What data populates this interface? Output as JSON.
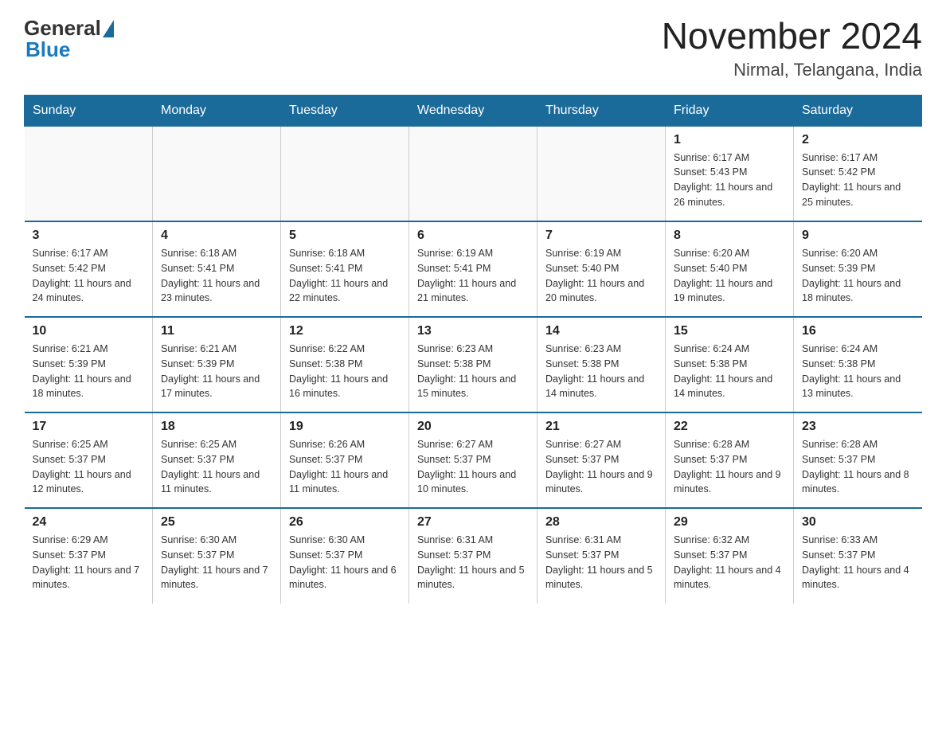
{
  "header": {
    "logo_general": "General",
    "logo_blue": "Blue",
    "month": "November 2024",
    "location": "Nirmal, Telangana, India"
  },
  "days_of_week": [
    "Sunday",
    "Monday",
    "Tuesday",
    "Wednesday",
    "Thursday",
    "Friday",
    "Saturday"
  ],
  "weeks": [
    [
      {
        "day": "",
        "info": ""
      },
      {
        "day": "",
        "info": ""
      },
      {
        "day": "",
        "info": ""
      },
      {
        "day": "",
        "info": ""
      },
      {
        "day": "",
        "info": ""
      },
      {
        "day": "1",
        "info": "Sunrise: 6:17 AM\nSunset: 5:43 PM\nDaylight: 11 hours and 26 minutes."
      },
      {
        "day": "2",
        "info": "Sunrise: 6:17 AM\nSunset: 5:42 PM\nDaylight: 11 hours and 25 minutes."
      }
    ],
    [
      {
        "day": "3",
        "info": "Sunrise: 6:17 AM\nSunset: 5:42 PM\nDaylight: 11 hours and 24 minutes."
      },
      {
        "day": "4",
        "info": "Sunrise: 6:18 AM\nSunset: 5:41 PM\nDaylight: 11 hours and 23 minutes."
      },
      {
        "day": "5",
        "info": "Sunrise: 6:18 AM\nSunset: 5:41 PM\nDaylight: 11 hours and 22 minutes."
      },
      {
        "day": "6",
        "info": "Sunrise: 6:19 AM\nSunset: 5:41 PM\nDaylight: 11 hours and 21 minutes."
      },
      {
        "day": "7",
        "info": "Sunrise: 6:19 AM\nSunset: 5:40 PM\nDaylight: 11 hours and 20 minutes."
      },
      {
        "day": "8",
        "info": "Sunrise: 6:20 AM\nSunset: 5:40 PM\nDaylight: 11 hours and 19 minutes."
      },
      {
        "day": "9",
        "info": "Sunrise: 6:20 AM\nSunset: 5:39 PM\nDaylight: 11 hours and 18 minutes."
      }
    ],
    [
      {
        "day": "10",
        "info": "Sunrise: 6:21 AM\nSunset: 5:39 PM\nDaylight: 11 hours and 18 minutes."
      },
      {
        "day": "11",
        "info": "Sunrise: 6:21 AM\nSunset: 5:39 PM\nDaylight: 11 hours and 17 minutes."
      },
      {
        "day": "12",
        "info": "Sunrise: 6:22 AM\nSunset: 5:38 PM\nDaylight: 11 hours and 16 minutes."
      },
      {
        "day": "13",
        "info": "Sunrise: 6:23 AM\nSunset: 5:38 PM\nDaylight: 11 hours and 15 minutes."
      },
      {
        "day": "14",
        "info": "Sunrise: 6:23 AM\nSunset: 5:38 PM\nDaylight: 11 hours and 14 minutes."
      },
      {
        "day": "15",
        "info": "Sunrise: 6:24 AM\nSunset: 5:38 PM\nDaylight: 11 hours and 14 minutes."
      },
      {
        "day": "16",
        "info": "Sunrise: 6:24 AM\nSunset: 5:38 PM\nDaylight: 11 hours and 13 minutes."
      }
    ],
    [
      {
        "day": "17",
        "info": "Sunrise: 6:25 AM\nSunset: 5:37 PM\nDaylight: 11 hours and 12 minutes."
      },
      {
        "day": "18",
        "info": "Sunrise: 6:25 AM\nSunset: 5:37 PM\nDaylight: 11 hours and 11 minutes."
      },
      {
        "day": "19",
        "info": "Sunrise: 6:26 AM\nSunset: 5:37 PM\nDaylight: 11 hours and 11 minutes."
      },
      {
        "day": "20",
        "info": "Sunrise: 6:27 AM\nSunset: 5:37 PM\nDaylight: 11 hours and 10 minutes."
      },
      {
        "day": "21",
        "info": "Sunrise: 6:27 AM\nSunset: 5:37 PM\nDaylight: 11 hours and 9 minutes."
      },
      {
        "day": "22",
        "info": "Sunrise: 6:28 AM\nSunset: 5:37 PM\nDaylight: 11 hours and 9 minutes."
      },
      {
        "day": "23",
        "info": "Sunrise: 6:28 AM\nSunset: 5:37 PM\nDaylight: 11 hours and 8 minutes."
      }
    ],
    [
      {
        "day": "24",
        "info": "Sunrise: 6:29 AM\nSunset: 5:37 PM\nDaylight: 11 hours and 7 minutes."
      },
      {
        "day": "25",
        "info": "Sunrise: 6:30 AM\nSunset: 5:37 PM\nDaylight: 11 hours and 7 minutes."
      },
      {
        "day": "26",
        "info": "Sunrise: 6:30 AM\nSunset: 5:37 PM\nDaylight: 11 hours and 6 minutes."
      },
      {
        "day": "27",
        "info": "Sunrise: 6:31 AM\nSunset: 5:37 PM\nDaylight: 11 hours and 5 minutes."
      },
      {
        "day": "28",
        "info": "Sunrise: 6:31 AM\nSunset: 5:37 PM\nDaylight: 11 hours and 5 minutes."
      },
      {
        "day": "29",
        "info": "Sunrise: 6:32 AM\nSunset: 5:37 PM\nDaylight: 11 hours and 4 minutes."
      },
      {
        "day": "30",
        "info": "Sunrise: 6:33 AM\nSunset: 5:37 PM\nDaylight: 11 hours and 4 minutes."
      }
    ]
  ]
}
